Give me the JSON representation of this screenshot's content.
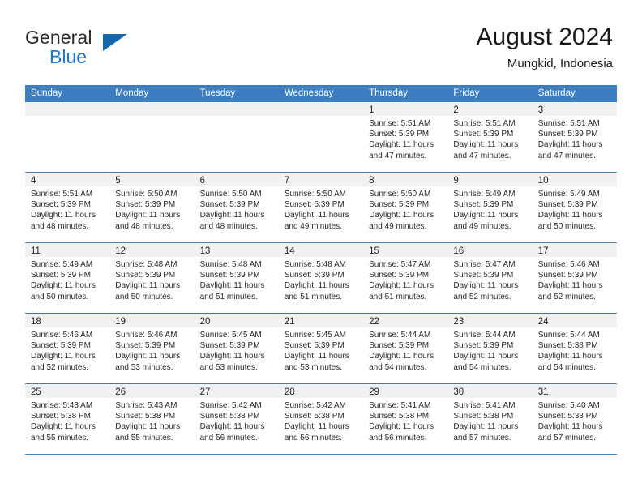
{
  "brand": {
    "word_general": "General",
    "word_blue": "Blue",
    "flag_color": "#1567ad"
  },
  "header": {
    "title": "August 2024",
    "subtitle": "Mungkid, Indonesia"
  },
  "theme": {
    "header_blue": "#3b7dbf",
    "daynum_band": "#f1f1f1",
    "text": "#2a2a2a"
  },
  "weekdays": [
    "Sunday",
    "Monday",
    "Tuesday",
    "Wednesday",
    "Thursday",
    "Friday",
    "Saturday"
  ],
  "weeks": [
    [
      {
        "day": "",
        "lines": []
      },
      {
        "day": "",
        "lines": []
      },
      {
        "day": "",
        "lines": []
      },
      {
        "day": "",
        "lines": []
      },
      {
        "day": "1",
        "lines": [
          "Sunrise: 5:51 AM",
          "Sunset: 5:39 PM",
          "Daylight: 11 hours",
          "and 47 minutes."
        ]
      },
      {
        "day": "2",
        "lines": [
          "Sunrise: 5:51 AM",
          "Sunset: 5:39 PM",
          "Daylight: 11 hours",
          "and 47 minutes."
        ]
      },
      {
        "day": "3",
        "lines": [
          "Sunrise: 5:51 AM",
          "Sunset: 5:39 PM",
          "Daylight: 11 hours",
          "and 47 minutes."
        ]
      }
    ],
    [
      {
        "day": "4",
        "lines": [
          "Sunrise: 5:51 AM",
          "Sunset: 5:39 PM",
          "Daylight: 11 hours",
          "and 48 minutes."
        ]
      },
      {
        "day": "5",
        "lines": [
          "Sunrise: 5:50 AM",
          "Sunset: 5:39 PM",
          "Daylight: 11 hours",
          "and 48 minutes."
        ]
      },
      {
        "day": "6",
        "lines": [
          "Sunrise: 5:50 AM",
          "Sunset: 5:39 PM",
          "Daylight: 11 hours",
          "and 48 minutes."
        ]
      },
      {
        "day": "7",
        "lines": [
          "Sunrise: 5:50 AM",
          "Sunset: 5:39 PM",
          "Daylight: 11 hours",
          "and 49 minutes."
        ]
      },
      {
        "day": "8",
        "lines": [
          "Sunrise: 5:50 AM",
          "Sunset: 5:39 PM",
          "Daylight: 11 hours",
          "and 49 minutes."
        ]
      },
      {
        "day": "9",
        "lines": [
          "Sunrise: 5:49 AM",
          "Sunset: 5:39 PM",
          "Daylight: 11 hours",
          "and 49 minutes."
        ]
      },
      {
        "day": "10",
        "lines": [
          "Sunrise: 5:49 AM",
          "Sunset: 5:39 PM",
          "Daylight: 11 hours",
          "and 50 minutes."
        ]
      }
    ],
    [
      {
        "day": "11",
        "lines": [
          "Sunrise: 5:49 AM",
          "Sunset: 5:39 PM",
          "Daylight: 11 hours",
          "and 50 minutes."
        ]
      },
      {
        "day": "12",
        "lines": [
          "Sunrise: 5:48 AM",
          "Sunset: 5:39 PM",
          "Daylight: 11 hours",
          "and 50 minutes."
        ]
      },
      {
        "day": "13",
        "lines": [
          "Sunrise: 5:48 AM",
          "Sunset: 5:39 PM",
          "Daylight: 11 hours",
          "and 51 minutes."
        ]
      },
      {
        "day": "14",
        "lines": [
          "Sunrise: 5:48 AM",
          "Sunset: 5:39 PM",
          "Daylight: 11 hours",
          "and 51 minutes."
        ]
      },
      {
        "day": "15",
        "lines": [
          "Sunrise: 5:47 AM",
          "Sunset: 5:39 PM",
          "Daylight: 11 hours",
          "and 51 minutes."
        ]
      },
      {
        "day": "16",
        "lines": [
          "Sunrise: 5:47 AM",
          "Sunset: 5:39 PM",
          "Daylight: 11 hours",
          "and 52 minutes."
        ]
      },
      {
        "day": "17",
        "lines": [
          "Sunrise: 5:46 AM",
          "Sunset: 5:39 PM",
          "Daylight: 11 hours",
          "and 52 minutes."
        ]
      }
    ],
    [
      {
        "day": "18",
        "lines": [
          "Sunrise: 5:46 AM",
          "Sunset: 5:39 PM",
          "Daylight: 11 hours",
          "and 52 minutes."
        ]
      },
      {
        "day": "19",
        "lines": [
          "Sunrise: 5:46 AM",
          "Sunset: 5:39 PM",
          "Daylight: 11 hours",
          "and 53 minutes."
        ]
      },
      {
        "day": "20",
        "lines": [
          "Sunrise: 5:45 AM",
          "Sunset: 5:39 PM",
          "Daylight: 11 hours",
          "and 53 minutes."
        ]
      },
      {
        "day": "21",
        "lines": [
          "Sunrise: 5:45 AM",
          "Sunset: 5:39 PM",
          "Daylight: 11 hours",
          "and 53 minutes."
        ]
      },
      {
        "day": "22",
        "lines": [
          "Sunrise: 5:44 AM",
          "Sunset: 5:39 PM",
          "Daylight: 11 hours",
          "and 54 minutes."
        ]
      },
      {
        "day": "23",
        "lines": [
          "Sunrise: 5:44 AM",
          "Sunset: 5:39 PM",
          "Daylight: 11 hours",
          "and 54 minutes."
        ]
      },
      {
        "day": "24",
        "lines": [
          "Sunrise: 5:44 AM",
          "Sunset: 5:38 PM",
          "Daylight: 11 hours",
          "and 54 minutes."
        ]
      }
    ],
    [
      {
        "day": "25",
        "lines": [
          "Sunrise: 5:43 AM",
          "Sunset: 5:38 PM",
          "Daylight: 11 hours",
          "and 55 minutes."
        ]
      },
      {
        "day": "26",
        "lines": [
          "Sunrise: 5:43 AM",
          "Sunset: 5:38 PM",
          "Daylight: 11 hours",
          "and 55 minutes."
        ]
      },
      {
        "day": "27",
        "lines": [
          "Sunrise: 5:42 AM",
          "Sunset: 5:38 PM",
          "Daylight: 11 hours",
          "and 56 minutes."
        ]
      },
      {
        "day": "28",
        "lines": [
          "Sunrise: 5:42 AM",
          "Sunset: 5:38 PM",
          "Daylight: 11 hours",
          "and 56 minutes."
        ]
      },
      {
        "day": "29",
        "lines": [
          "Sunrise: 5:41 AM",
          "Sunset: 5:38 PM",
          "Daylight: 11 hours",
          "and 56 minutes."
        ]
      },
      {
        "day": "30",
        "lines": [
          "Sunrise: 5:41 AM",
          "Sunset: 5:38 PM",
          "Daylight: 11 hours",
          "and 57 minutes."
        ]
      },
      {
        "day": "31",
        "lines": [
          "Sunrise: 5:40 AM",
          "Sunset: 5:38 PM",
          "Daylight: 11 hours",
          "and 57 minutes."
        ]
      }
    ]
  ]
}
